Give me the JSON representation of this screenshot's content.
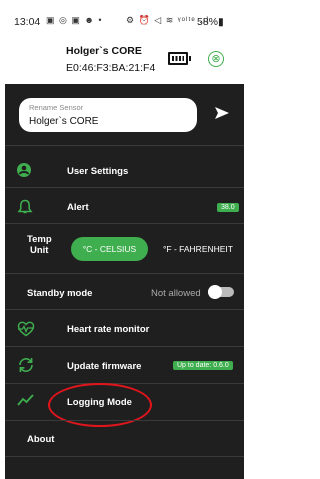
{
  "status_bar": {
    "time": "13:04",
    "left_icons": "▣ ◎ ▣ ☻ •",
    "right_icons": "⚙ ⏰ ◁ ≋ ᵞᵒˡᵗᵉ .ıl",
    "battery_text": "58%▮"
  },
  "device": {
    "name": "Holger`s CORE",
    "mac": "E0:46:F3:BA:21:F4"
  },
  "rename": {
    "placeholder": "Rename Sensor",
    "value": "Holger`s CORE"
  },
  "menu": {
    "user_settings": "User Settings",
    "alert": "Alert",
    "alert_value": "38.0",
    "temp_unit_label_line1": "Temp",
    "temp_unit_label_line2": "Unit",
    "celsius": "°C - CELSIUS",
    "fahrenheit": "°F - FAHRENHEIT",
    "standby_mode": "Standby mode",
    "standby_value": "Not allowed",
    "heart_rate_monitor": "Heart rate monitor",
    "update_firmware": "Update firmware",
    "firmware_status": "Up to date: 0.6.0",
    "logging_mode": "Logging Mode",
    "about": "About"
  },
  "colors": {
    "accent": "#3fae4f",
    "menu_bg": "#1f1f1f",
    "highlight": "#e0161c"
  }
}
